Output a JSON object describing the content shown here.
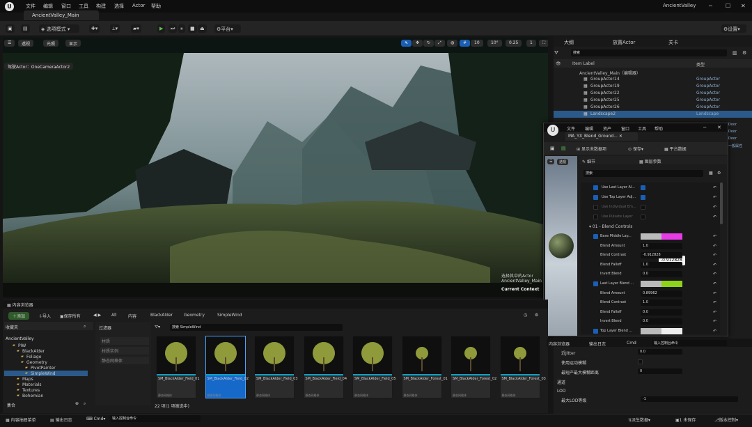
{
  "menu": {
    "items": [
      "文件",
      "编辑",
      "窗口",
      "工具",
      "构建",
      "选择",
      "Actor",
      "帮助"
    ],
    "project": "AncientValley"
  },
  "tab": {
    "label": "AncientValley_Main"
  },
  "toolbar": {
    "mode": "选项模式",
    "platform": "平台",
    "settings": "设置"
  },
  "viewport": {
    "persp": "透视",
    "lit": "光照",
    "show": "显示",
    "pilot": "驾驶Actor：OneCameraActor2",
    "pilot_sub": "选择其中的Actor",
    "pilot_name": "AncientValley_Main",
    "context": "Current Context",
    "grid": "10",
    "angle": "10°",
    "scale": "0.25",
    "speed": "1"
  },
  "outliner": {
    "tabs": [
      "大纲",
      "放置Actor",
      "关卡"
    ],
    "search_placeholder": "搜索",
    "col_label": "Item Label",
    "col_type": "类型",
    "root": "AncientValley_Main（编辑器）",
    "rows": [
      {
        "name": "GroupActor14",
        "type": "GroupActor"
      },
      {
        "name": "GroupActor19",
        "type": "GroupActor"
      },
      {
        "name": "GroupActor22",
        "type": "GroupActor"
      },
      {
        "name": "GroupActor25",
        "type": "GroupActor"
      },
      {
        "name": "GroupActor26",
        "type": "GroupActor"
      },
      {
        "name": "Landscape2",
        "type": "Landscape"
      }
    ]
  },
  "material": {
    "menu": [
      "文件",
      "编辑",
      "资产",
      "窗口",
      "工具",
      "帮助"
    ],
    "tab": "MA_YX_Blend_Ground...",
    "apply": "显示未数据项",
    "save": "保存",
    "platform": "平台数据",
    "details_tab": "细节",
    "params_tab": "图层参数",
    "viewport_btn": "透视",
    "search_placeholder": "搜索",
    "popup": "-0.912828",
    "params": [
      {
        "label": "Use Last Layer Al...",
        "checked": true,
        "value": ""
      },
      {
        "label": "Use Top Layer Adj...",
        "checked": true,
        "value": ""
      },
      {
        "label": "Use Individual Em...",
        "checked": false,
        "value": ""
      },
      {
        "label": "Use Pulsate Layer",
        "checked": false,
        "value": ""
      }
    ],
    "group1": "01 - Blend Controls",
    "blend": [
      {
        "label": "Base Middle Lay...",
        "value": "",
        "color": "#e63ce6"
      },
      {
        "label": "Blend Amount",
        "value": "1.0"
      },
      {
        "label": "Blend Contrast",
        "value": "-0.912828"
      },
      {
        "label": "Blend Falloff",
        "value": "1.0"
      },
      {
        "label": "Invert Blend",
        "value": "0.0"
      },
      {
        "label": "Last Layer Blend ...",
        "value": "",
        "color": "#8fd21a"
      },
      {
        "label": "Blend Amount",
        "value": "0.89962"
      },
      {
        "label": "Blend Contrast",
        "value": "1.0"
      },
      {
        "label": "Blend Falloff",
        "value": "0.0"
      },
      {
        "label": "Invert Blend",
        "value": "0.0"
      },
      {
        "label": "Top Layer Blend ...",
        "value": "",
        "color": "#eeeeee"
      }
    ]
  },
  "content": {
    "tab": "内容浏览器",
    "add": "添加",
    "import": "导入",
    "save_all": "保存所有",
    "path": [
      "All",
      "内容",
      "BlackAlder",
      "Geometry",
      "SimpleWind"
    ],
    "favorites": "收藏夹",
    "filter": "过滤器",
    "project": "AncientValley",
    "search_placeholder": "搜索 SimpleWind",
    "filters": [
      "材质",
      "材质实例",
      "静态网格体"
    ],
    "tree": [
      "PIW",
      "BlackAlder",
      "Foliage",
      "Geometry",
      "PivotPainter",
      "SimpleWind",
      "Maps",
      "Materials",
      "Textures",
      "Bohemian"
    ],
    "assets": [
      {
        "name": "SM_BlackAlder_Field_01",
        "type": "静态网格体"
      },
      {
        "name": "SM_BlackAlder_Field_02",
        "type": "静态网格体"
      },
      {
        "name": "SM_BlackAlder_Field_03",
        "type": "静态网格体"
      },
      {
        "name": "SM_BlackAlder_Field_04",
        "type": "静态网格体"
      },
      {
        "name": "SM_BlackAlder_Field_05",
        "type": "静态网格体"
      },
      {
        "name": "SM_BlackAlder_Forest_01",
        "type": "静态网格体"
      },
      {
        "name": "SM_BlackAlder_Forest_02",
        "type": "静态网格体"
      },
      {
        "name": "SM_BlackAlder_Forest_03",
        "type": "静态网格体"
      }
    ],
    "count": "22 项(1 项被选中)",
    "collection": "集合"
  },
  "lower_right": {
    "tabs": [
      "内容浏览器",
      "输出日志",
      "Cmd"
    ],
    "cmd_placeholder": "输入控制台命令",
    "rows": [
      {
        "label": "近Jitter",
        "value": "0.0"
      },
      {
        "label": "使用运动模糊",
        "value": ""
      },
      {
        "label": "最短产最大模糊距离",
        "value": "0"
      }
    ],
    "sec1": "通道",
    "sec2": "LOD",
    "lod_label": "最大LOD等级",
    "lod_value": "-1",
    "side": [
      "Door",
      "Door",
      "Door",
      "一般属性"
    ]
  },
  "status": {
    "content": "内容抽屉菜单",
    "output": "输出日志",
    "cmd": "Cmd",
    "cmd_placeholder": "输入控制台命令",
    "drawer": "派生数据",
    "save": "1 未保存",
    "source": "版本控制"
  }
}
